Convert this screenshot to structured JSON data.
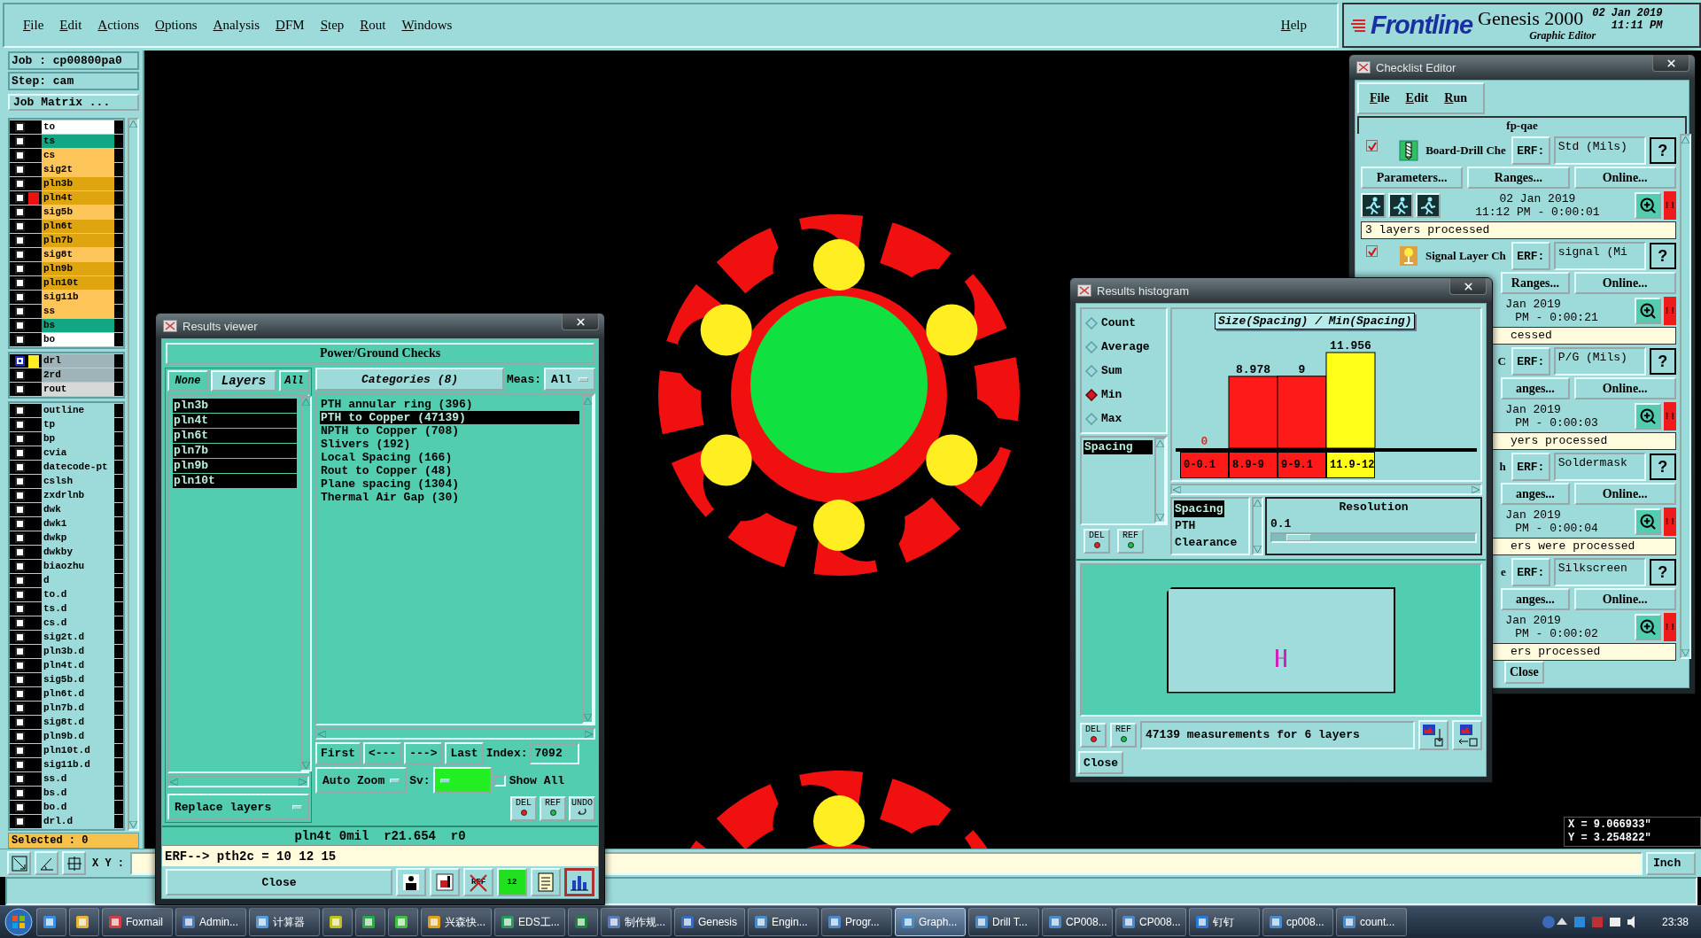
{
  "menu_bar": {
    "items": [
      "File",
      "Edit",
      "Actions",
      "Options",
      "Analysis",
      "DFM",
      "Step",
      "Rout",
      "Windows"
    ],
    "help": "Help"
  },
  "brand": {
    "logo": "Frontline",
    "product": "Genesis 2000",
    "subtitle": "Graphic Editor",
    "date": "02 Jan 2019",
    "time": "11:11 PM"
  },
  "job_panel": {
    "job": "Job : cp00800pa0",
    "step": "Step: cam",
    "matrix_button": "Job Matrix ...",
    "layer_groups": [
      [
        {
          "name": "to",
          "color": "#ffffff",
          "work": false
        },
        {
          "name": "ts",
          "color": "#13a683",
          "work": false
        },
        {
          "name": "cs",
          "color": "#fdc55a",
          "work": false
        },
        {
          "name": "sig2t",
          "color": "#fdc55a",
          "work": false
        },
        {
          "name": "pln3b",
          "color": "#dea510",
          "work": false
        },
        {
          "name": "pln4t",
          "color": "#dea510",
          "work": false,
          "display": {
            "color": "#ee1111"
          }
        },
        {
          "name": "sig5b",
          "color": "#fdc55a",
          "work": false
        },
        {
          "name": "pln6t",
          "color": "#dea510",
          "work": false
        },
        {
          "name": "pln7b",
          "color": "#dea510",
          "work": false
        },
        {
          "name": "sig8t",
          "color": "#fdc55a",
          "work": false
        },
        {
          "name": "pln9b",
          "color": "#dea510",
          "work": false
        },
        {
          "name": "pln10t",
          "color": "#dea510",
          "work": false
        },
        {
          "name": "sig11b",
          "color": "#fdc55a",
          "work": false
        },
        {
          "name": "ss",
          "color": "#fdc55a",
          "work": false
        },
        {
          "name": "bs",
          "color": "#13a683",
          "work": false
        },
        {
          "name": "bo",
          "color": "#ffffff",
          "work": false
        }
      ],
      [
        {
          "name": "drl",
          "color": "#9fb4b8",
          "work": true,
          "display": {
            "color": "#ffee22"
          }
        },
        {
          "name": "2rd",
          "color": "#9fb4b8",
          "work": false
        },
        {
          "name": "rout",
          "color": "#d8d8d8",
          "work": false
        }
      ],
      [
        {
          "name": "outline",
          "color": "#9ddada",
          "work": false
        },
        {
          "name": "tp",
          "color": "#9ddada",
          "work": false
        },
        {
          "name": "bp",
          "color": "#9ddada",
          "work": false
        },
        {
          "name": "cvia",
          "color": "#9ddada",
          "work": false
        },
        {
          "name": "datecode-pt",
          "color": "#9ddada",
          "work": false
        },
        {
          "name": "cslsh",
          "color": "#9ddada",
          "work": false
        },
        {
          "name": "zxdrlnb",
          "color": "#9ddada",
          "work": false
        },
        {
          "name": "dwk",
          "color": "#9ddada",
          "work": false
        },
        {
          "name": "dwk1",
          "color": "#9ddada",
          "work": false
        },
        {
          "name": "dwkp",
          "color": "#9ddada",
          "work": false
        },
        {
          "name": "dwkby",
          "color": "#9ddada",
          "work": false
        },
        {
          "name": "biaozhu",
          "color": "#9ddada",
          "work": false
        },
        {
          "name": "d",
          "color": "#9ddada",
          "work": false
        },
        {
          "name": "to.d",
          "color": "#9ddada",
          "work": false
        },
        {
          "name": "ts.d",
          "color": "#9ddada",
          "work": false
        },
        {
          "name": "cs.d",
          "color": "#9ddada",
          "work": false
        },
        {
          "name": "sig2t.d",
          "color": "#9ddada",
          "work": false
        },
        {
          "name": "pln3b.d",
          "color": "#9ddada",
          "work": false
        },
        {
          "name": "pln4t.d",
          "color": "#9ddada",
          "work": false
        },
        {
          "name": "sig5b.d",
          "color": "#9ddada",
          "work": false
        },
        {
          "name": "pln6t.d",
          "color": "#9ddada",
          "work": false
        },
        {
          "name": "pln7b.d",
          "color": "#9ddada",
          "work": false
        },
        {
          "name": "sig8t.d",
          "color": "#9ddada",
          "work": false
        },
        {
          "name": "pln9b.d",
          "color": "#9ddada",
          "work": false
        },
        {
          "name": "pln10t.d",
          "color": "#9ddada",
          "work": false
        },
        {
          "name": "sig11b.d",
          "color": "#9ddada",
          "work": false
        },
        {
          "name": "ss.d",
          "color": "#9ddada",
          "work": false
        },
        {
          "name": "bs.d",
          "color": "#9ddada",
          "work": false
        },
        {
          "name": "bo.d",
          "color": "#9ddada",
          "work": false
        },
        {
          "name": "drl.d",
          "color": "#9ddada",
          "work": false
        }
      ]
    ],
    "selected": "Selected : 0"
  },
  "canvas": {
    "x": "X = 9.066933\"",
    "y": "Y = 3.254822\""
  },
  "coord_bar": {
    "label": "X Y :",
    "units": "Inch"
  },
  "results_viewer": {
    "title": "Results viewer",
    "heading": "Power/Ground Checks",
    "layer_buttons": [
      "None",
      "Layers",
      "All"
    ],
    "layers": [
      {
        "name": "pln3b",
        "selected": true
      },
      {
        "name": "pln4t",
        "selected": true
      },
      {
        "name": "pln6t",
        "selected": true
      },
      {
        "name": "pln7b",
        "selected": true
      },
      {
        "name": "pln9b",
        "selected": true
      },
      {
        "name": "pln10t",
        "selected": true
      }
    ],
    "categories_header": "Categories (8)",
    "meas_label": "Meas:",
    "meas_value": "All",
    "categories": [
      {
        "label": "PTH annular ring (396)",
        "selected": false
      },
      {
        "label": "PTH to Copper (47139)",
        "selected": true
      },
      {
        "label": "NPTH to Copper (708)",
        "selected": false
      },
      {
        "label": "Slivers (192)",
        "selected": false
      },
      {
        "label": "Local Spacing (166)",
        "selected": false
      },
      {
        "label": "Rout to Copper (48)",
        "selected": false
      },
      {
        "label": "Plane spacing (1304)",
        "selected": false
      },
      {
        "label": "Thermal Air Gap (30)",
        "selected": false
      }
    ],
    "nav_buttons": [
      "First",
      "<---",
      "--->",
      "Last"
    ],
    "index_label": "Index:",
    "index_value": "7092",
    "zoom_mode": "Auto Zoom",
    "sv_label": "Sv:",
    "show_all": {
      "label": "Show All",
      "checked": false
    },
    "replace_mode": "Replace layers",
    "tool_buttons": [
      "DEL",
      "REF",
      "UNDO"
    ],
    "status": "pln4t 0mil  r21.654  r0",
    "erf": "ERF--> pth2c = 10 12 15",
    "close": "Close",
    "footer_tools": [
      {
        "kind": "figure",
        "selected": false
      },
      {
        "kind": "marker",
        "selected": false
      },
      {
        "kind": "no_ref",
        "text": "REF",
        "selected": false
      },
      {
        "kind": "page",
        "text": "12",
        "selected": false
      },
      {
        "kind": "report",
        "selected": false
      },
      {
        "kind": "histogram",
        "selected": true
      }
    ]
  },
  "checklist": {
    "title": "Checklist Editor",
    "menu": [
      "File",
      "Edit",
      "Run"
    ],
    "name": "fp-qae",
    "items": [
      {
        "checked": true,
        "kind": "drill",
        "name": "Board-Drill Che",
        "erf_label": "ERF:",
        "erf": "Std (Mils)",
        "help": "?",
        "buttons": [
          "Parameters...",
          "Ranges...",
          "Online..."
        ],
        "date": "02 Jan 2019",
        "time": "11:12 PM - 0:00:01",
        "alert": "!!",
        "status": "3 layers processed"
      },
      {
        "checked": true,
        "kind": "probe",
        "name": "Signal Layer Ch",
        "erf_label": "ERF:",
        "erf": "signal (Mi",
        "help": "?",
        "buttons": [
          "Ranges...",
          "Online..."
        ],
        "date": "Jan 2019",
        "time": "PM - 0:00:21",
        "alert": "!!",
        "status": "cessed"
      },
      {
        "name": "C",
        "erf_label": "ERF:",
        "erf": "P/G (Mils)",
        "help": "?",
        "buttons": [
          "anges...",
          "Online..."
        ],
        "date": "Jan 2019",
        "time": "PM - 0:00:03",
        "alert": "!!",
        "status": "yers processed"
      },
      {
        "name": "h",
        "erf_label": "ERF:",
        "erf": "Soldermask",
        "help": "?",
        "buttons": [
          "anges...",
          "Online..."
        ],
        "date": "Jan 2019",
        "time": "PM - 0:00:04",
        "alert": "!!",
        "status": "ers were processed"
      },
      {
        "name": "e",
        "erf_label": "ERF:",
        "erf": "Silkscreen",
        "help": "?",
        "buttons": [
          "anges...",
          "Online..."
        ],
        "date": "Jan 2019",
        "time": "PM - 0:00:02",
        "alert": "!!",
        "status": "ers processed"
      }
    ],
    "close": "Close"
  },
  "histogram": {
    "title": "Results histogram",
    "modes": [
      {
        "label": "Count",
        "selected": false
      },
      {
        "label": "Average",
        "selected": false
      },
      {
        "label": "Sum",
        "selected": false
      },
      {
        "label": "Min",
        "selected": true
      },
      {
        "label": "Max",
        "selected": false
      }
    ],
    "measures": [
      {
        "label": "Spacing",
        "selected": true
      }
    ],
    "mode_tools": [
      "DEL",
      "REF"
    ],
    "chart_data": {
      "type": "bar",
      "title": "Size(Spacing) / Min(Spacing)",
      "categories": [
        "0-0.1",
        "8.9-9",
        "9-9.1",
        "11.9-12"
      ],
      "series": [
        {
          "color": "#ff1a1a",
          "values": [
            0,
            8.978,
            9,
            null
          ]
        },
        {
          "color": "#ffff1a",
          "values": [
            null,
            null,
            null,
            11.956
          ]
        }
      ],
      "stacked": true,
      "data_labels": true
    },
    "types": [
      {
        "label": "Spacing",
        "selected": true
      },
      {
        "label": "PTH",
        "selected": false
      },
      {
        "label": "Clearance",
        "selected": false
      }
    ],
    "resolution": {
      "label": "Resolution",
      "value": "0.1",
      "level": 0.08
    },
    "footer_tools": [
      "DEL",
      "REF"
    ],
    "summary": "47139 measurements for 6 layers",
    "close": "Close"
  },
  "taskbar": {
    "items": [
      {
        "kind": "pinned",
        "selected": false
      },
      {
        "kind": "pinned",
        "selected": false
      },
      {
        "kind": "app",
        "label": "Foxmail",
        "selected": false
      },
      {
        "kind": "app",
        "label": "Admin...",
        "selected": false
      },
      {
        "kind": "app",
        "label": "计算器",
        "selected": false
      },
      {
        "kind": "pinned",
        "selected": false
      },
      {
        "kind": "pinned",
        "selected": false
      },
      {
        "kind": "pinned",
        "selected": false
      },
      {
        "kind": "app",
        "label": "兴森快...",
        "selected": false
      },
      {
        "kind": "app",
        "label": "EDS工...",
        "selected": false
      },
      {
        "kind": "pinned",
        "selected": false
      },
      {
        "kind": "app",
        "label": "制作规...",
        "selected": false
      },
      {
        "kind": "app",
        "label": "Genesis",
        "selected": false
      },
      {
        "kind": "app",
        "label": "Engin...",
        "selected": false
      },
      {
        "kind": "app",
        "label": "Progr...",
        "selected": false
      },
      {
        "kind": "app",
        "label": "Graph...",
        "selected": true
      },
      {
        "kind": "app",
        "label": "Drill T...",
        "selected": false
      },
      {
        "kind": "app",
        "label": "CP008...",
        "selected": false
      },
      {
        "kind": "app",
        "label": "CP008...",
        "selected": false
      },
      {
        "kind": "app",
        "label": "钉钉",
        "selected": false
      },
      {
        "kind": "app",
        "label": "cp008...",
        "selected": false
      },
      {
        "kind": "app",
        "label": "count...",
        "selected": false
      }
    ],
    "clock": "23:38"
  }
}
